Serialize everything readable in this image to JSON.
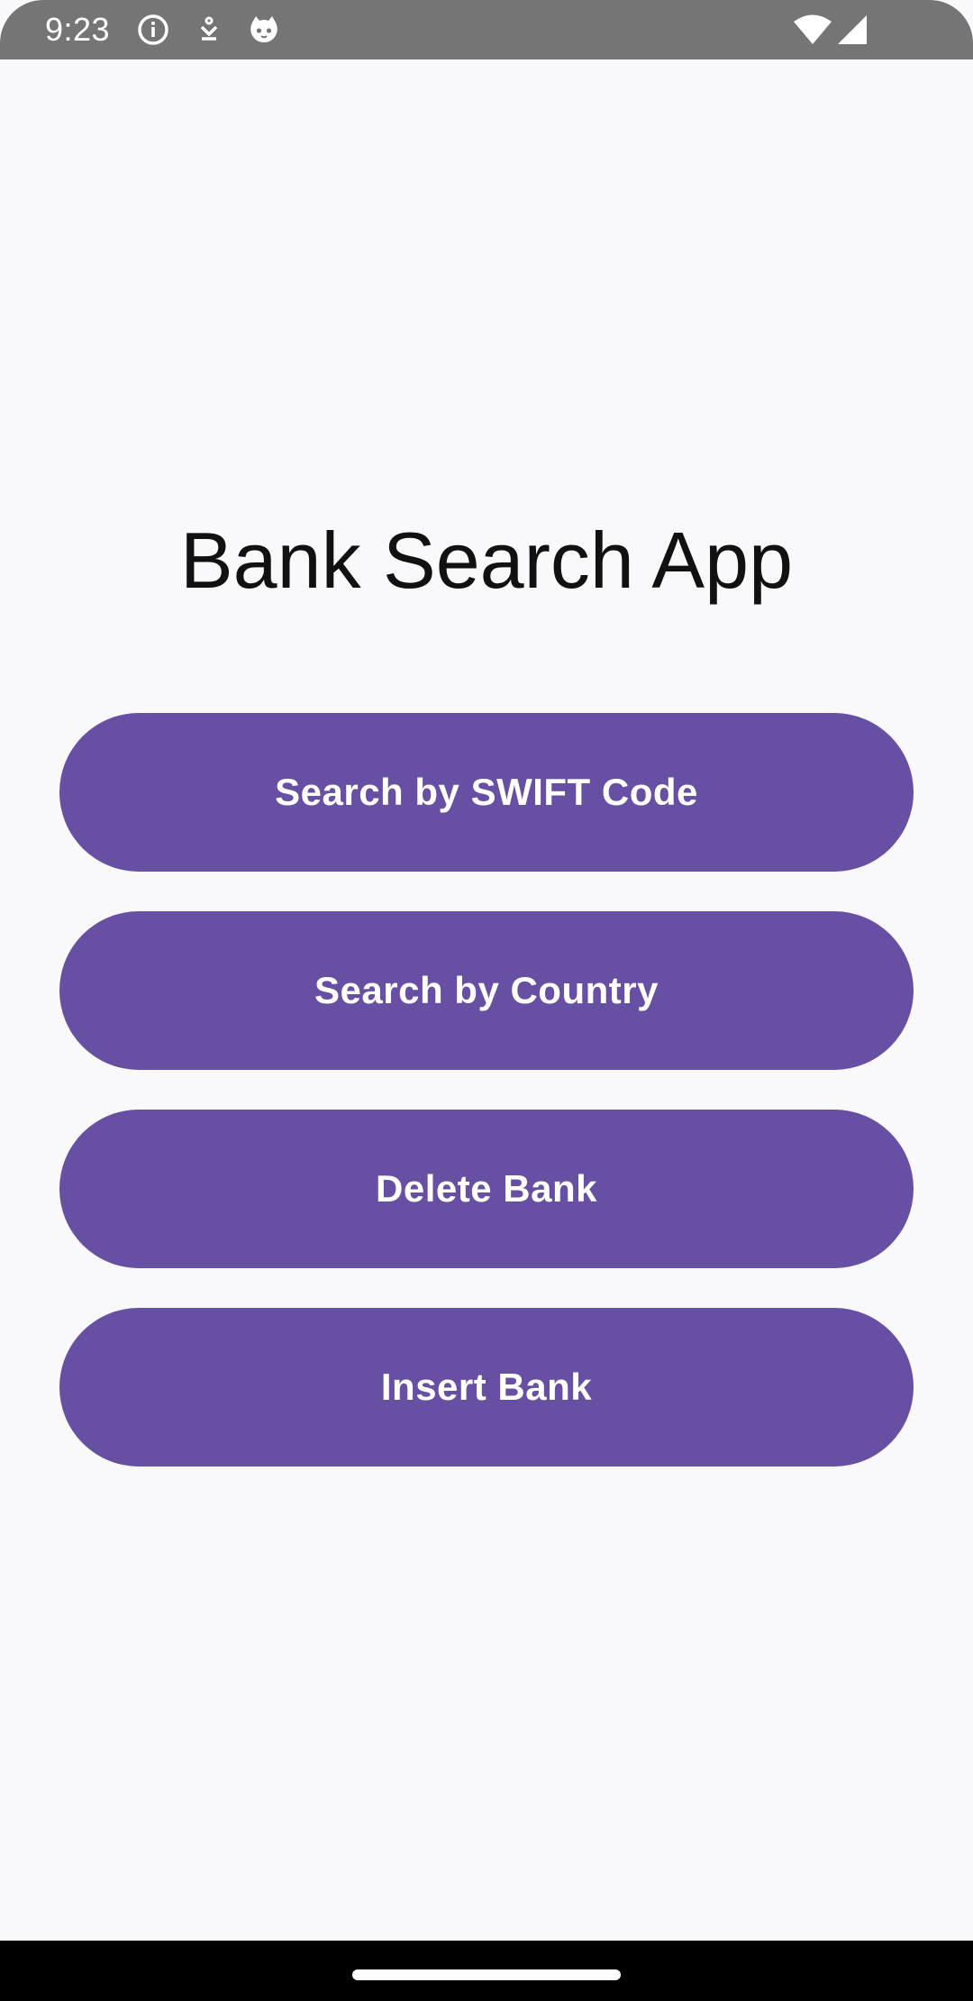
{
  "status_bar": {
    "time": "9:23",
    "icons": [
      "info-icon",
      "download-icon",
      "cat-face-icon",
      "wifi-icon",
      "signal-icon"
    ]
  },
  "app": {
    "title": "Bank Search App"
  },
  "buttons": {
    "search_swift": "Search by SWIFT Code",
    "search_country": "Search by Country",
    "delete_bank": "Delete Bank",
    "insert_bank": "Insert Bank"
  },
  "colors": {
    "primary": "#6750a4",
    "background": "#f9f9fb",
    "status_bar": "#757575",
    "nav_bar": "#000000"
  }
}
